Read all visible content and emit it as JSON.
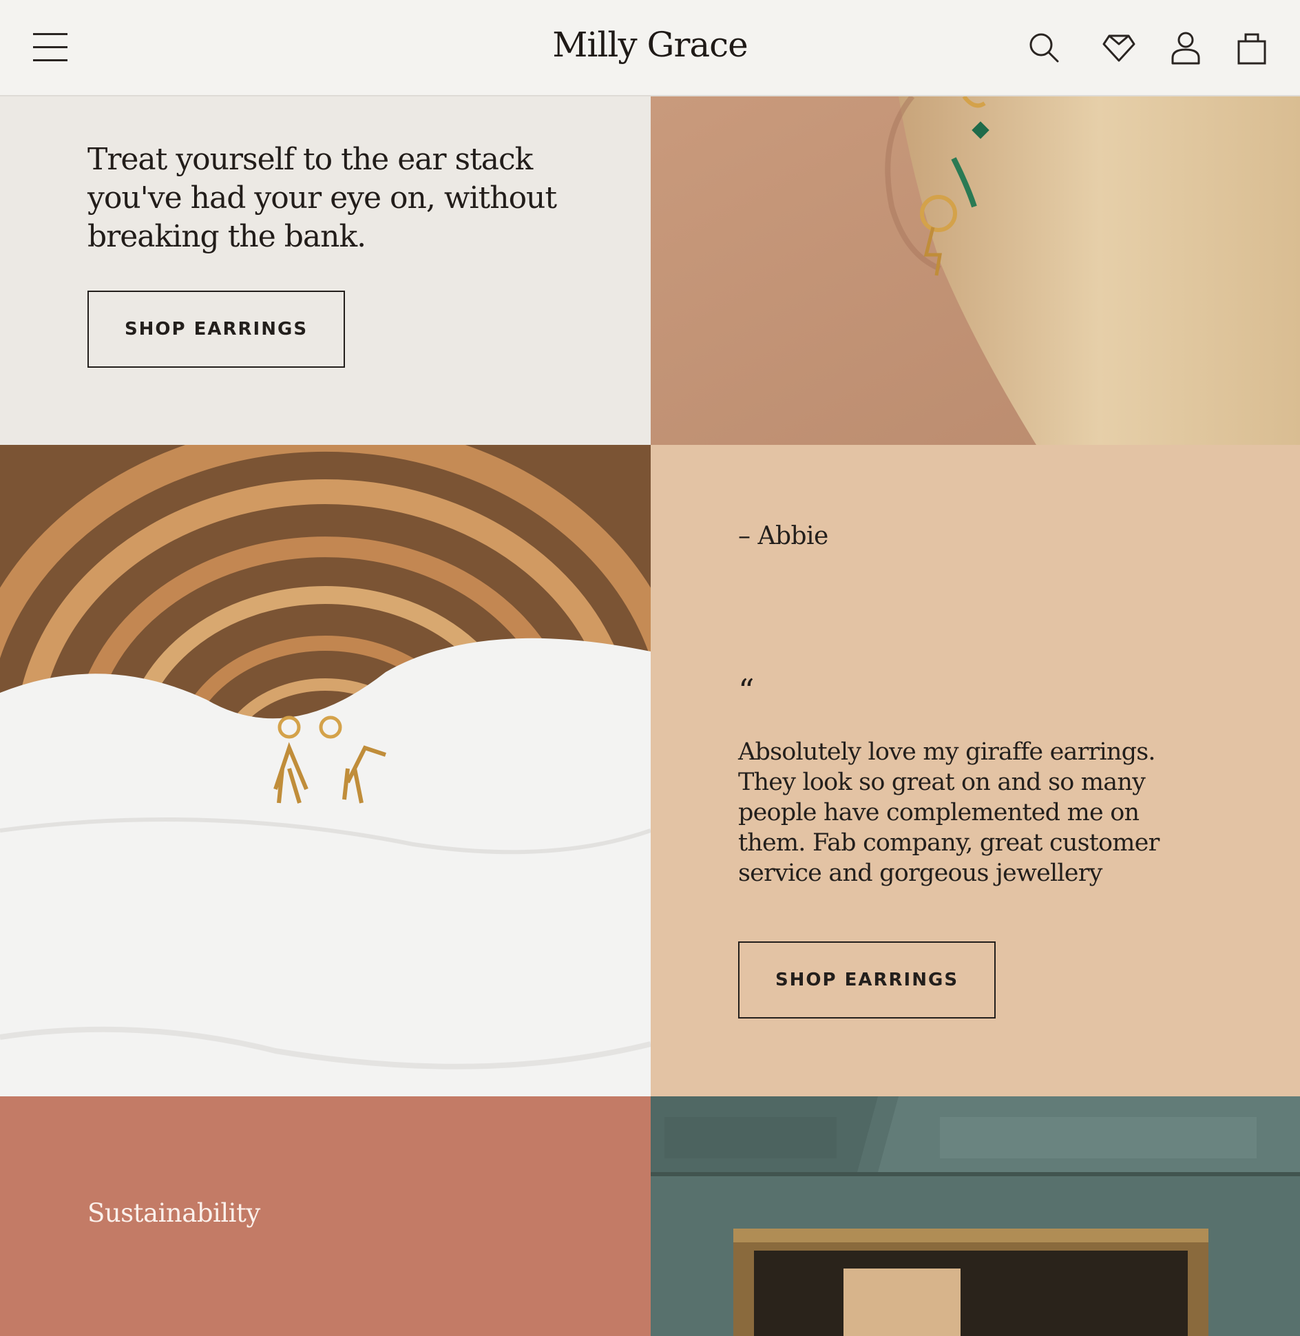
{
  "header": {
    "logo": "Milly Grace",
    "icons": {
      "menu": "hamburger-menu-icon",
      "search": "search-icon",
      "wishlist": "heart-icon",
      "account": "user-icon",
      "cart": "bag-icon"
    }
  },
  "promo": {
    "headline": "Treat yourself to the ear stack you've had your eye on, without breaking the bank.",
    "button": "SHOP EARRINGS"
  },
  "testimonial": {
    "author": "– Abbie",
    "quote_mark": "“",
    "quote": "Absolutely love my giraffe earrings. They look so great on and so many people have complemented me on them. Fab company, great customer service and gorgeous jewellery",
    "button": "SHOP EARRINGS"
  },
  "sustainability": {
    "title": "Sustainability"
  },
  "colors": {
    "header_bg": "#f4f3f0",
    "promo_bg": "#ece9e4",
    "testimonial_bg": "#e3c3a4",
    "sustainability_bg": "#c37b66",
    "text": "#231f1c"
  }
}
